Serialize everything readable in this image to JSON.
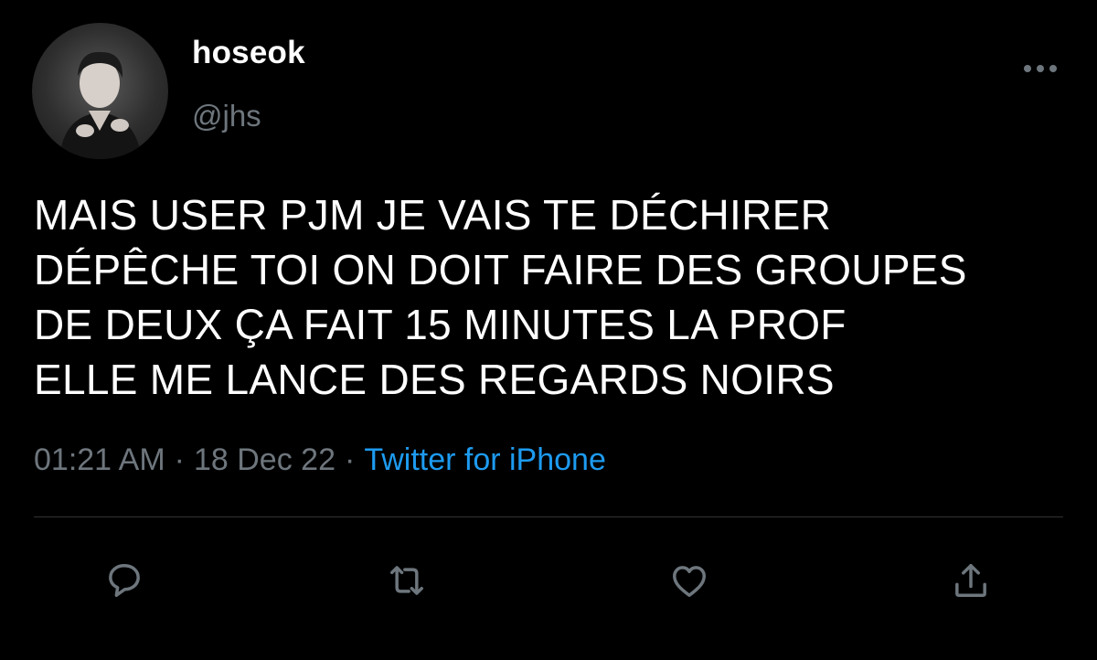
{
  "tweet": {
    "author": {
      "display_name": "hoseok",
      "handle": "@jhs"
    },
    "text_lines": [
      "MAIS USER PJM JE VAIS TE DÉCHIRER",
      "DÉPÊCHE TOI ON DOIT FAIRE DES GROUPES",
      "DE DEUX ÇA FAIT 15 MINUTES LA PROF",
      "ELLE ME LANCE DES REGARDS NOIRS"
    ],
    "meta": {
      "time": "01:21 AM",
      "separator": "·",
      "date": "18 Dec 22",
      "source": "Twitter for iPhone"
    }
  },
  "actions": {
    "reply_icon": "speech-bubble-icon",
    "retweet_icon": "retweet-arrows-icon",
    "like_icon": "heart-icon",
    "share_icon": "share-upload-icon"
  },
  "colors": {
    "background": "#000000",
    "primary_text": "#ffffff",
    "secondary_text": "#6e767d",
    "link": "#1d9bf0",
    "divider": "#2f3336"
  }
}
